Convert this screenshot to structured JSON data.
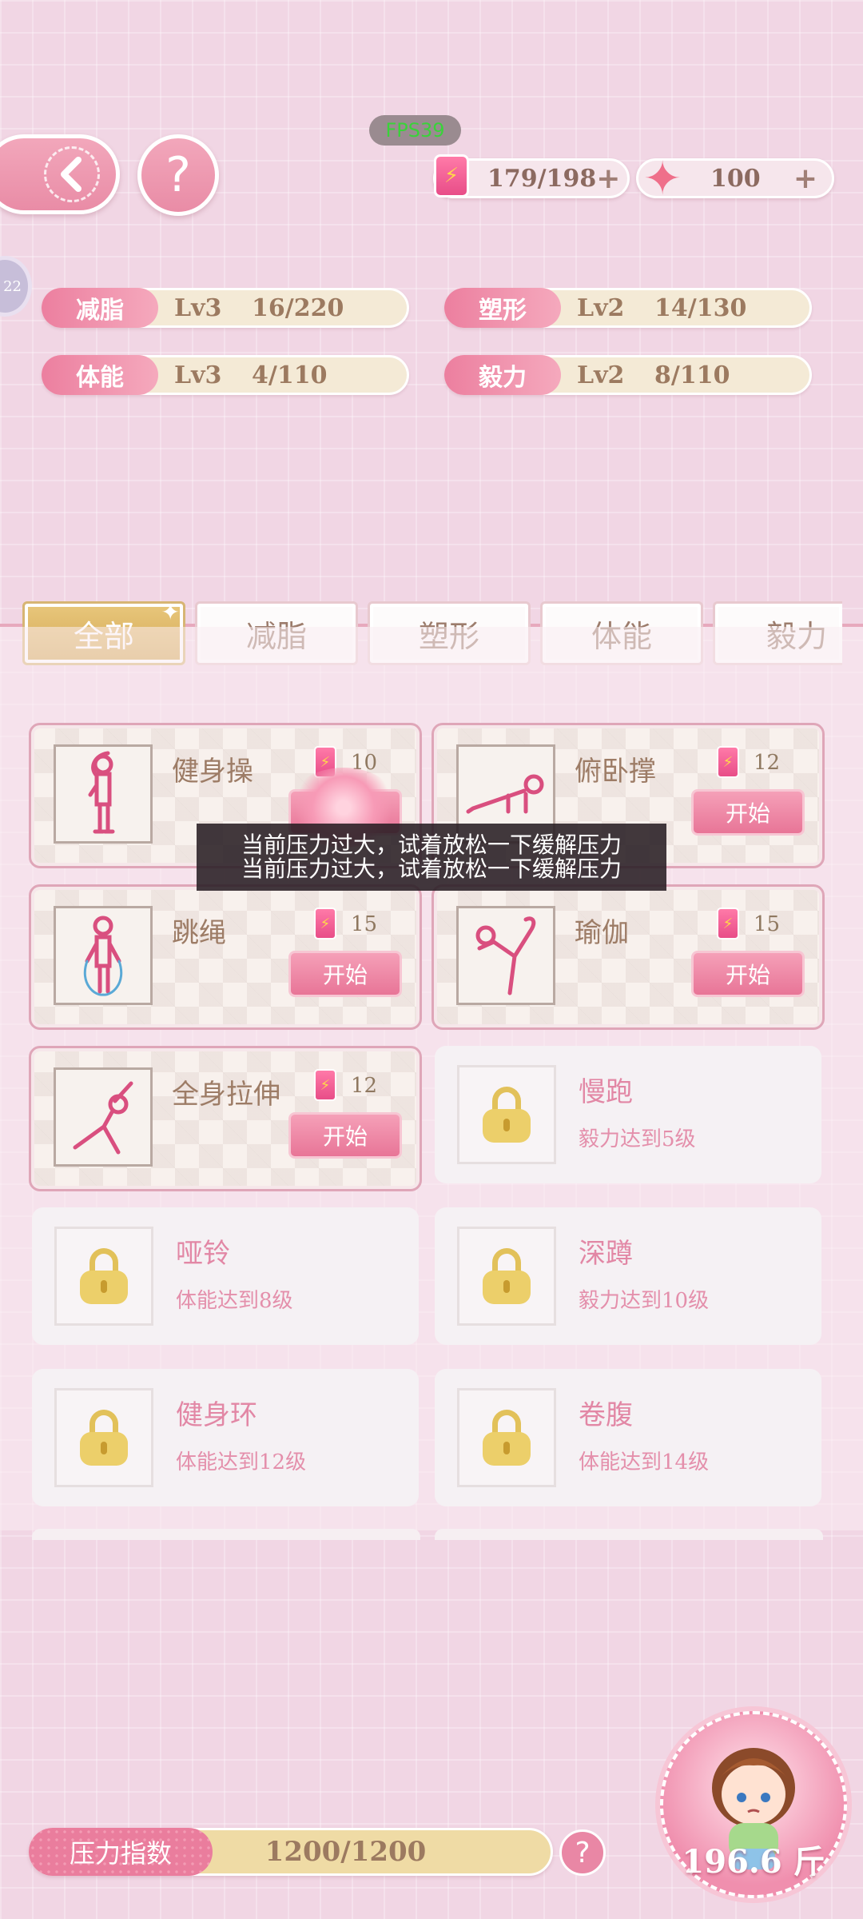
{
  "fps_label": "FPS39",
  "side_badge": "22",
  "currency": {
    "energy": "179/198",
    "gems": "100",
    "plus": "+"
  },
  "stats": [
    {
      "name": "减脂",
      "level": "Lv3",
      "exp": "16/220"
    },
    {
      "name": "塑形",
      "level": "Lv2",
      "exp": "14/130"
    },
    {
      "name": "体能",
      "level": "Lv3",
      "exp": "4/110"
    },
    {
      "name": "毅力",
      "level": "Lv2",
      "exp": "8/110"
    }
  ],
  "tabs": [
    "全部",
    "减脂",
    "塑形",
    "体能",
    "毅力"
  ],
  "start_label": "开始",
  "exercises": [
    {
      "name": "健身操",
      "cost": "10"
    },
    {
      "name": "俯卧撑",
      "cost": "12"
    },
    {
      "name": "跳绳",
      "cost": "15"
    },
    {
      "name": "瑜伽",
      "cost": "15"
    },
    {
      "name": "全身拉伸",
      "cost": "12"
    }
  ],
  "locked": [
    {
      "name": "慢跑",
      "req": "毅力达到5级"
    },
    {
      "name": "哑铃",
      "req": "体能达到8级"
    },
    {
      "name": "深蹲",
      "req": "毅力达到10级"
    },
    {
      "name": "健身环",
      "req": "体能达到12级"
    },
    {
      "name": "卷腹",
      "req": "体能达到14级"
    }
  ],
  "toast": {
    "line1": "当前压力过大，试着放松一下缓解压力",
    "line2": "当前压力过大，试着放松一下缓解压力"
  },
  "pressure": {
    "label": "压力指数",
    "value": "1200/1200"
  },
  "weight": "196.6 斤",
  "colors": {
    "pink": "#ea7d9d",
    "gold": "#d4a855",
    "background": "#f1d6e4"
  }
}
